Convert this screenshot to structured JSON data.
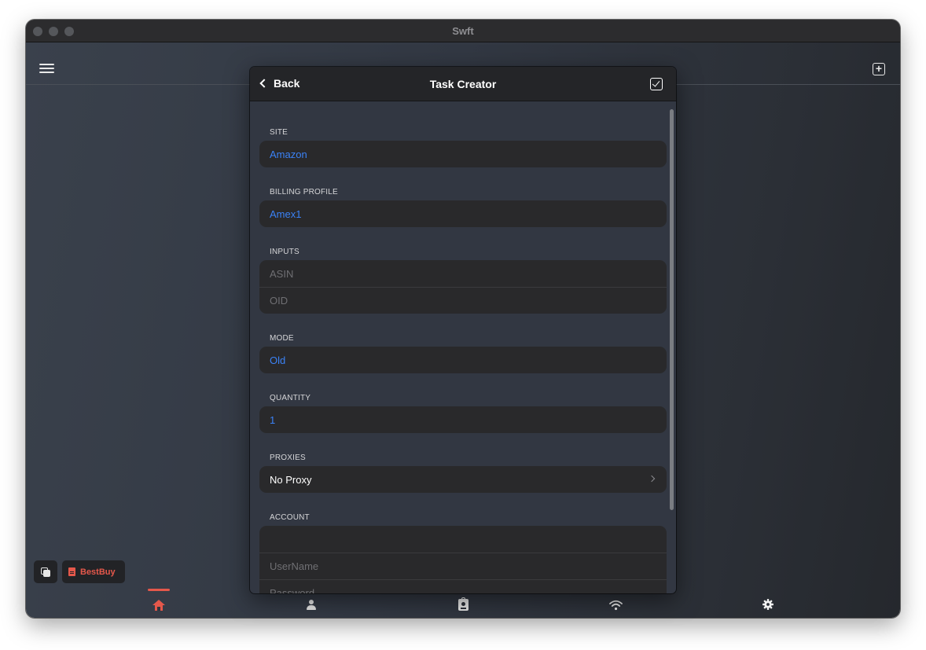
{
  "window": {
    "title": "Swft"
  },
  "tabs_bottom": {
    "active": "home",
    "items": [
      {
        "id": "home",
        "icon": "home-icon"
      },
      {
        "id": "profile",
        "icon": "person-icon"
      },
      {
        "id": "accounts",
        "icon": "badge-icon"
      },
      {
        "id": "proxies",
        "icon": "wifi-icon"
      },
      {
        "id": "settings",
        "icon": "gear-icon"
      }
    ]
  },
  "store_button": {
    "label": "BestBuy",
    "icon": "document-icon"
  },
  "modal": {
    "back_label": "Back",
    "title": "Task Creator",
    "sections": {
      "site": {
        "label": "SITE",
        "value": "Amazon"
      },
      "billing_profile": {
        "label": "BILLING PROFILE",
        "value": "Amex1"
      },
      "inputs": {
        "label": "INPUTS",
        "asin_placeholder": "ASIN",
        "oid_placeholder": "OID"
      },
      "mode": {
        "label": "MODE",
        "value": "Old"
      },
      "quantity": {
        "label": "QUANTITY",
        "value": "1"
      },
      "proxies": {
        "label": "PROXIES",
        "value": "No Proxy"
      },
      "account": {
        "label": "ACCOUNT",
        "value": "",
        "username_placeholder": "UserName",
        "password_placeholder": "Password"
      }
    }
  },
  "colors": {
    "accent": "#e5584b",
    "value_blue": "#3b82f6",
    "field_bg": "#29292b",
    "header_bg": "#242528"
  }
}
